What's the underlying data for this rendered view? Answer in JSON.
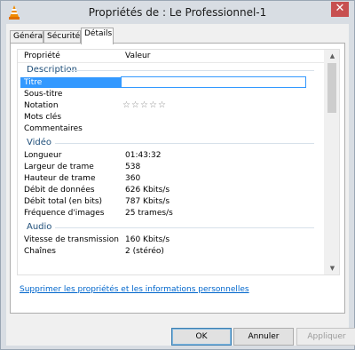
{
  "window": {
    "title": "Propriétés de : Le Professionnel-1",
    "close_glyph": "✕",
    "app_icon": "vlc-cone-icon"
  },
  "tabs": [
    {
      "label": "Général",
      "active": false
    },
    {
      "label": "Sécurité",
      "active": false
    },
    {
      "label": "Détails",
      "active": true
    }
  ],
  "list": {
    "columns": {
      "property": "Propriété",
      "value": "Valeur"
    },
    "groups": {
      "description": "Description",
      "video": "Vidéo",
      "audio": "Audio"
    },
    "rows": {
      "title": {
        "name": "Titre",
        "value": ""
      },
      "subtitle": {
        "name": "Sous-titre",
        "value": ""
      },
      "rating": {
        "name": "Notation",
        "stars": 0,
        "max": 5
      },
      "keywords": {
        "name": "Mots clés",
        "value": ""
      },
      "comments": {
        "name": "Commentaires",
        "value": ""
      },
      "length": {
        "name": "Longueur",
        "value": "01:43:32"
      },
      "frame_width": {
        "name": "Largeur de trame",
        "value": "538"
      },
      "frame_height": {
        "name": "Hauteur de trame",
        "value": "360"
      },
      "data_rate": {
        "name": "Débit de données",
        "value": "626 Kbits/s"
      },
      "total_bitrate": {
        "name": "Débit total (en bits)",
        "value": "787 Kbits/s"
      },
      "frame_rate": {
        "name": "Fréquence d'images",
        "value": "25 trames/s"
      },
      "audio_bitrate": {
        "name": "Vitesse de transmission",
        "value": "160 Kbits/s"
      },
      "channels": {
        "name": "Chaînes",
        "value": "2 (stéréo)"
      }
    }
  },
  "link": "Supprimer les propriétés et les informations personnelles",
  "buttons": {
    "ok": "OK",
    "cancel": "Annuler",
    "apply": "Appliquer"
  },
  "colors": {
    "selection": "#3399ff",
    "group_header": "#1e4e79",
    "link": "#0066cc"
  }
}
